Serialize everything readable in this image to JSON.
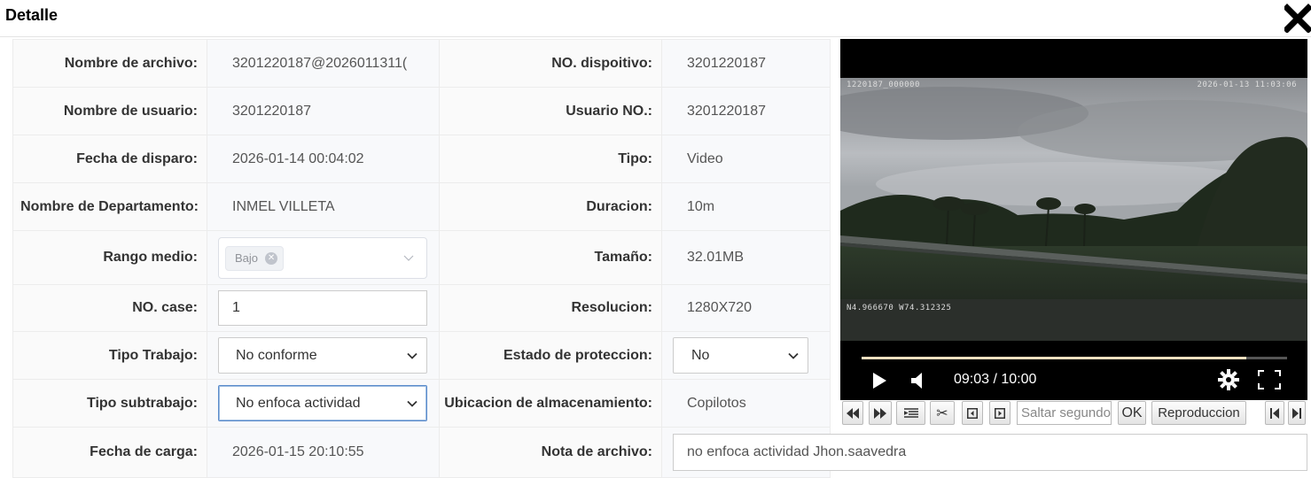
{
  "dialog": {
    "title": "Detalle"
  },
  "fields": {
    "nombre_archivo": {
      "label": "Nombre de archivo:",
      "value": "3201220187@2026011311("
    },
    "no_dispositivo": {
      "label": "NO. dispoitivo:",
      "value": "3201220187"
    },
    "nombre_usuario": {
      "label": "Nombre de usuario:",
      "value": "3201220187"
    },
    "usuario_no": {
      "label": "Usuario NO.:",
      "value": "3201220187"
    },
    "fecha_disparo": {
      "label": "Fecha de disparo:",
      "value": "2026-01-14 00:04:02"
    },
    "tipo": {
      "label": "Tipo:",
      "value": "Video"
    },
    "departamento": {
      "label": "Nombre de Departamento:",
      "value": "INMEL VILLETA"
    },
    "duracion": {
      "label": "Duracion:",
      "value": "10m"
    },
    "rango_medio": {
      "label": "Rango medio:",
      "tag": "Bajo"
    },
    "tamano": {
      "label": "Tamaño:",
      "value": "32.01MB"
    },
    "no_case": {
      "label": "NO. case:",
      "value": "1"
    },
    "resolucion": {
      "label": "Resolucion:",
      "value": "1280X720"
    },
    "tipo_trabajo": {
      "label": "Tipo Trabajo:",
      "selected": "No conforme"
    },
    "estado_proteccion": {
      "label": "Estado de proteccion:",
      "selected": "No"
    },
    "tipo_subtrabajo": {
      "label": "Tipo subtrabajo:",
      "selected": "No enfoca actividad"
    },
    "ubicacion": {
      "label": "Ubicacion de almacenamiento:",
      "value": "Copilotos"
    },
    "fecha_carga": {
      "label": "Fecha de carga:",
      "value": "2026-01-15 20:10:55"
    },
    "nota_archivo": {
      "label": "Nota de archivo:",
      "value": "no enfoca actividad Jhon.saavedra"
    }
  },
  "player": {
    "osd_id": "1220187_000000",
    "osd_datetime": "2026-01-13 11:03:06",
    "osd_coords": "N4.966670 W74.312325",
    "time_display": "09:03 / 10:00",
    "progress_fraction": 0.905
  },
  "toolbar": {
    "seek_placeholder": "Saltar segundos",
    "ok_label": "OK",
    "playback_label": "Reproduccion"
  },
  "icons": {
    "close": "close-icon",
    "play": "play-icon",
    "volume": "volume-icon",
    "settings": "gear-icon",
    "fullscreen": "fullscreen-icon",
    "rewind": "rewind-icon",
    "fast_forward": "fast-forward-icon",
    "list": "list-icon",
    "cut": "scissors-icon",
    "prev_frame": "prev-frame-icon",
    "next_frame": "next-frame-icon",
    "skip_start": "skip-start-icon",
    "skip_end": "skip-end-icon"
  }
}
